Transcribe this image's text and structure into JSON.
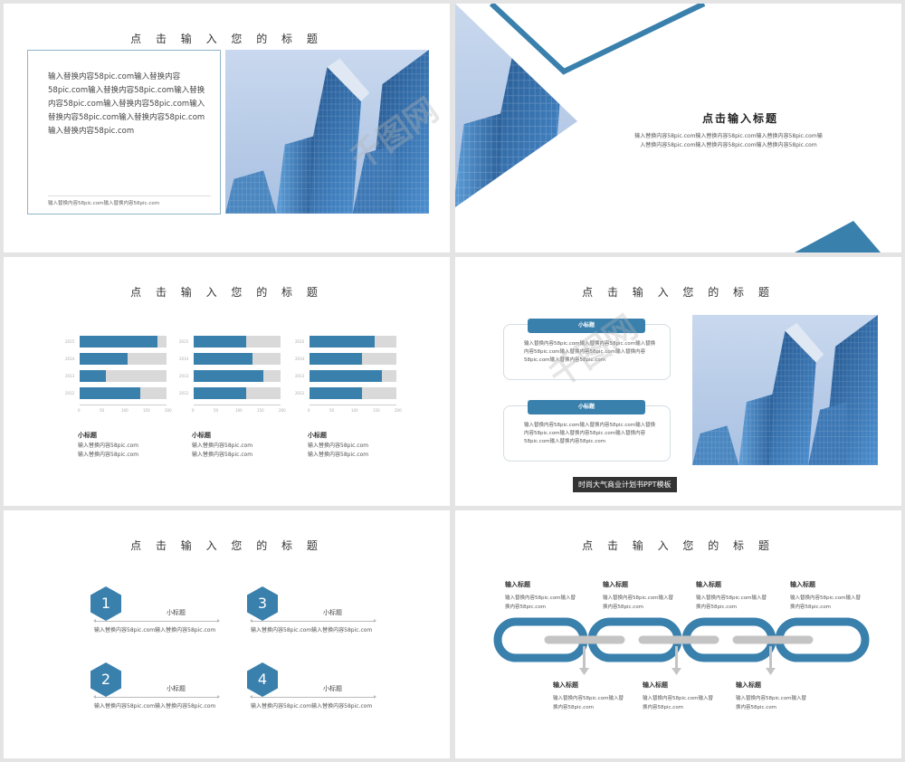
{
  "default_title": "点 击 输 入 您 的 标 题",
  "slide1": {
    "title": "点 击 输 入 您 的 标 题",
    "body": "输入替换内容58pic.com输入替换内容58pic.com输入替换内容58pic.com输入替换内容58pic.com输入替换内容58pic.com输入替换内容58pic.com输入替换内容58pic.com输入替换内容58pic.com",
    "footer": "输入替换内容58pic.com输入替换内容58pic.com"
  },
  "slide2": {
    "title": "点击输入标题",
    "body": "输入替换内容58pic.com输入替换内容58pic.com输入替换内容58pic.com输入替换内容58pic.com输入替换内容58pic.com输入替换内容58pic.com"
  },
  "slide3": {
    "title": "点 击 输 入 您 的 标 题",
    "charts": [
      {
        "years": [
          "2015",
          "2014",
          "2013",
          "2012"
        ],
        "values": [
          90,
          55,
          30,
          70
        ],
        "subtitle": "小标题",
        "text1": "输入替换内容58pic.com",
        "text2": "输入替换内容58pic.com"
      },
      {
        "years": [
          "2015",
          "2014",
          "2013",
          "2012"
        ],
        "values": [
          60,
          68,
          80,
          60
        ],
        "subtitle": "小标题",
        "text1": "输入替换内容58pic.com",
        "text2": "输入替换内容58pic.com"
      },
      {
        "years": [
          "2015",
          "2014",
          "2013",
          "2012"
        ],
        "values": [
          75,
          60,
          83,
          60
        ],
        "subtitle": "小标题",
        "text1": "输入替换内容58pic.com",
        "text2": "输入替换内容58pic.com"
      }
    ],
    "x_ticks": [
      "0",
      "50",
      "100",
      "150",
      "200"
    ]
  },
  "slide4": {
    "title": "点 击 输 入 您 的 标 题",
    "cards": [
      {
        "head": "小标题",
        "text": "输入替换内容58pic.com输入替换内容58pic.com输入替换内容58pic.com输入替换内容58pic.com输入替换内容58pic.com输入替换内容58pic.com"
      },
      {
        "head": "小标题",
        "text": "输入替换内容58pic.com输入替换内容58pic.com输入替换内容58pic.com输入替换内容58pic.com输入替换内容58pic.com输入替换内容58pic.com"
      }
    ],
    "caption": "时尚大气商业计划书PPT模板"
  },
  "slide5": {
    "title": "点 击 输 入 您 的 标 题",
    "items": [
      {
        "num": "1",
        "subtitle": "小标题",
        "text": "输入替换内容58pic.com输入替换内容58pic.com"
      },
      {
        "num": "3",
        "subtitle": "小标题",
        "text": "输入替换内容58pic.com输入替换内容58pic.com"
      },
      {
        "num": "2",
        "subtitle": "小标题",
        "text": "输入替换内容58pic.com输入替换内容58pic.com"
      },
      {
        "num": "4",
        "subtitle": "小标题",
        "text": "输入替换内容58pic.com输入替换内容58pic.com"
      }
    ]
  },
  "slide6": {
    "title": "点 击 输 入 您 的 标 题",
    "top": [
      {
        "head": "输入标题",
        "text": "输入替换内容58pic.com输入替换内容58pic.com"
      },
      {
        "head": "输入标题",
        "text": "输入替换内容58pic.com输入替换内容58pic.com"
      },
      {
        "head": "输入标题",
        "text": "输入替换内容58pic.com输入替换内容58pic.com"
      },
      {
        "head": "输入标题",
        "text": "输入替换内容58pic.com输入替换内容58pic.com"
      }
    ],
    "bottom": [
      {
        "head": "输入标题",
        "text": "输入替换内容58pic.com输入替换内容58pic.com"
      },
      {
        "head": "输入标题",
        "text": "输入替换内容58pic.com输入替换内容58pic.com"
      },
      {
        "head": "输入标题",
        "text": "输入替换内容58pic.com输入替换内容58pic.com"
      }
    ]
  },
  "watermark": "千图网",
  "colors": {
    "accent": "#3a80ad",
    "gray": "#d9d9d9",
    "sky": "#b9cde8",
    "glass": "#2f6ea8"
  }
}
